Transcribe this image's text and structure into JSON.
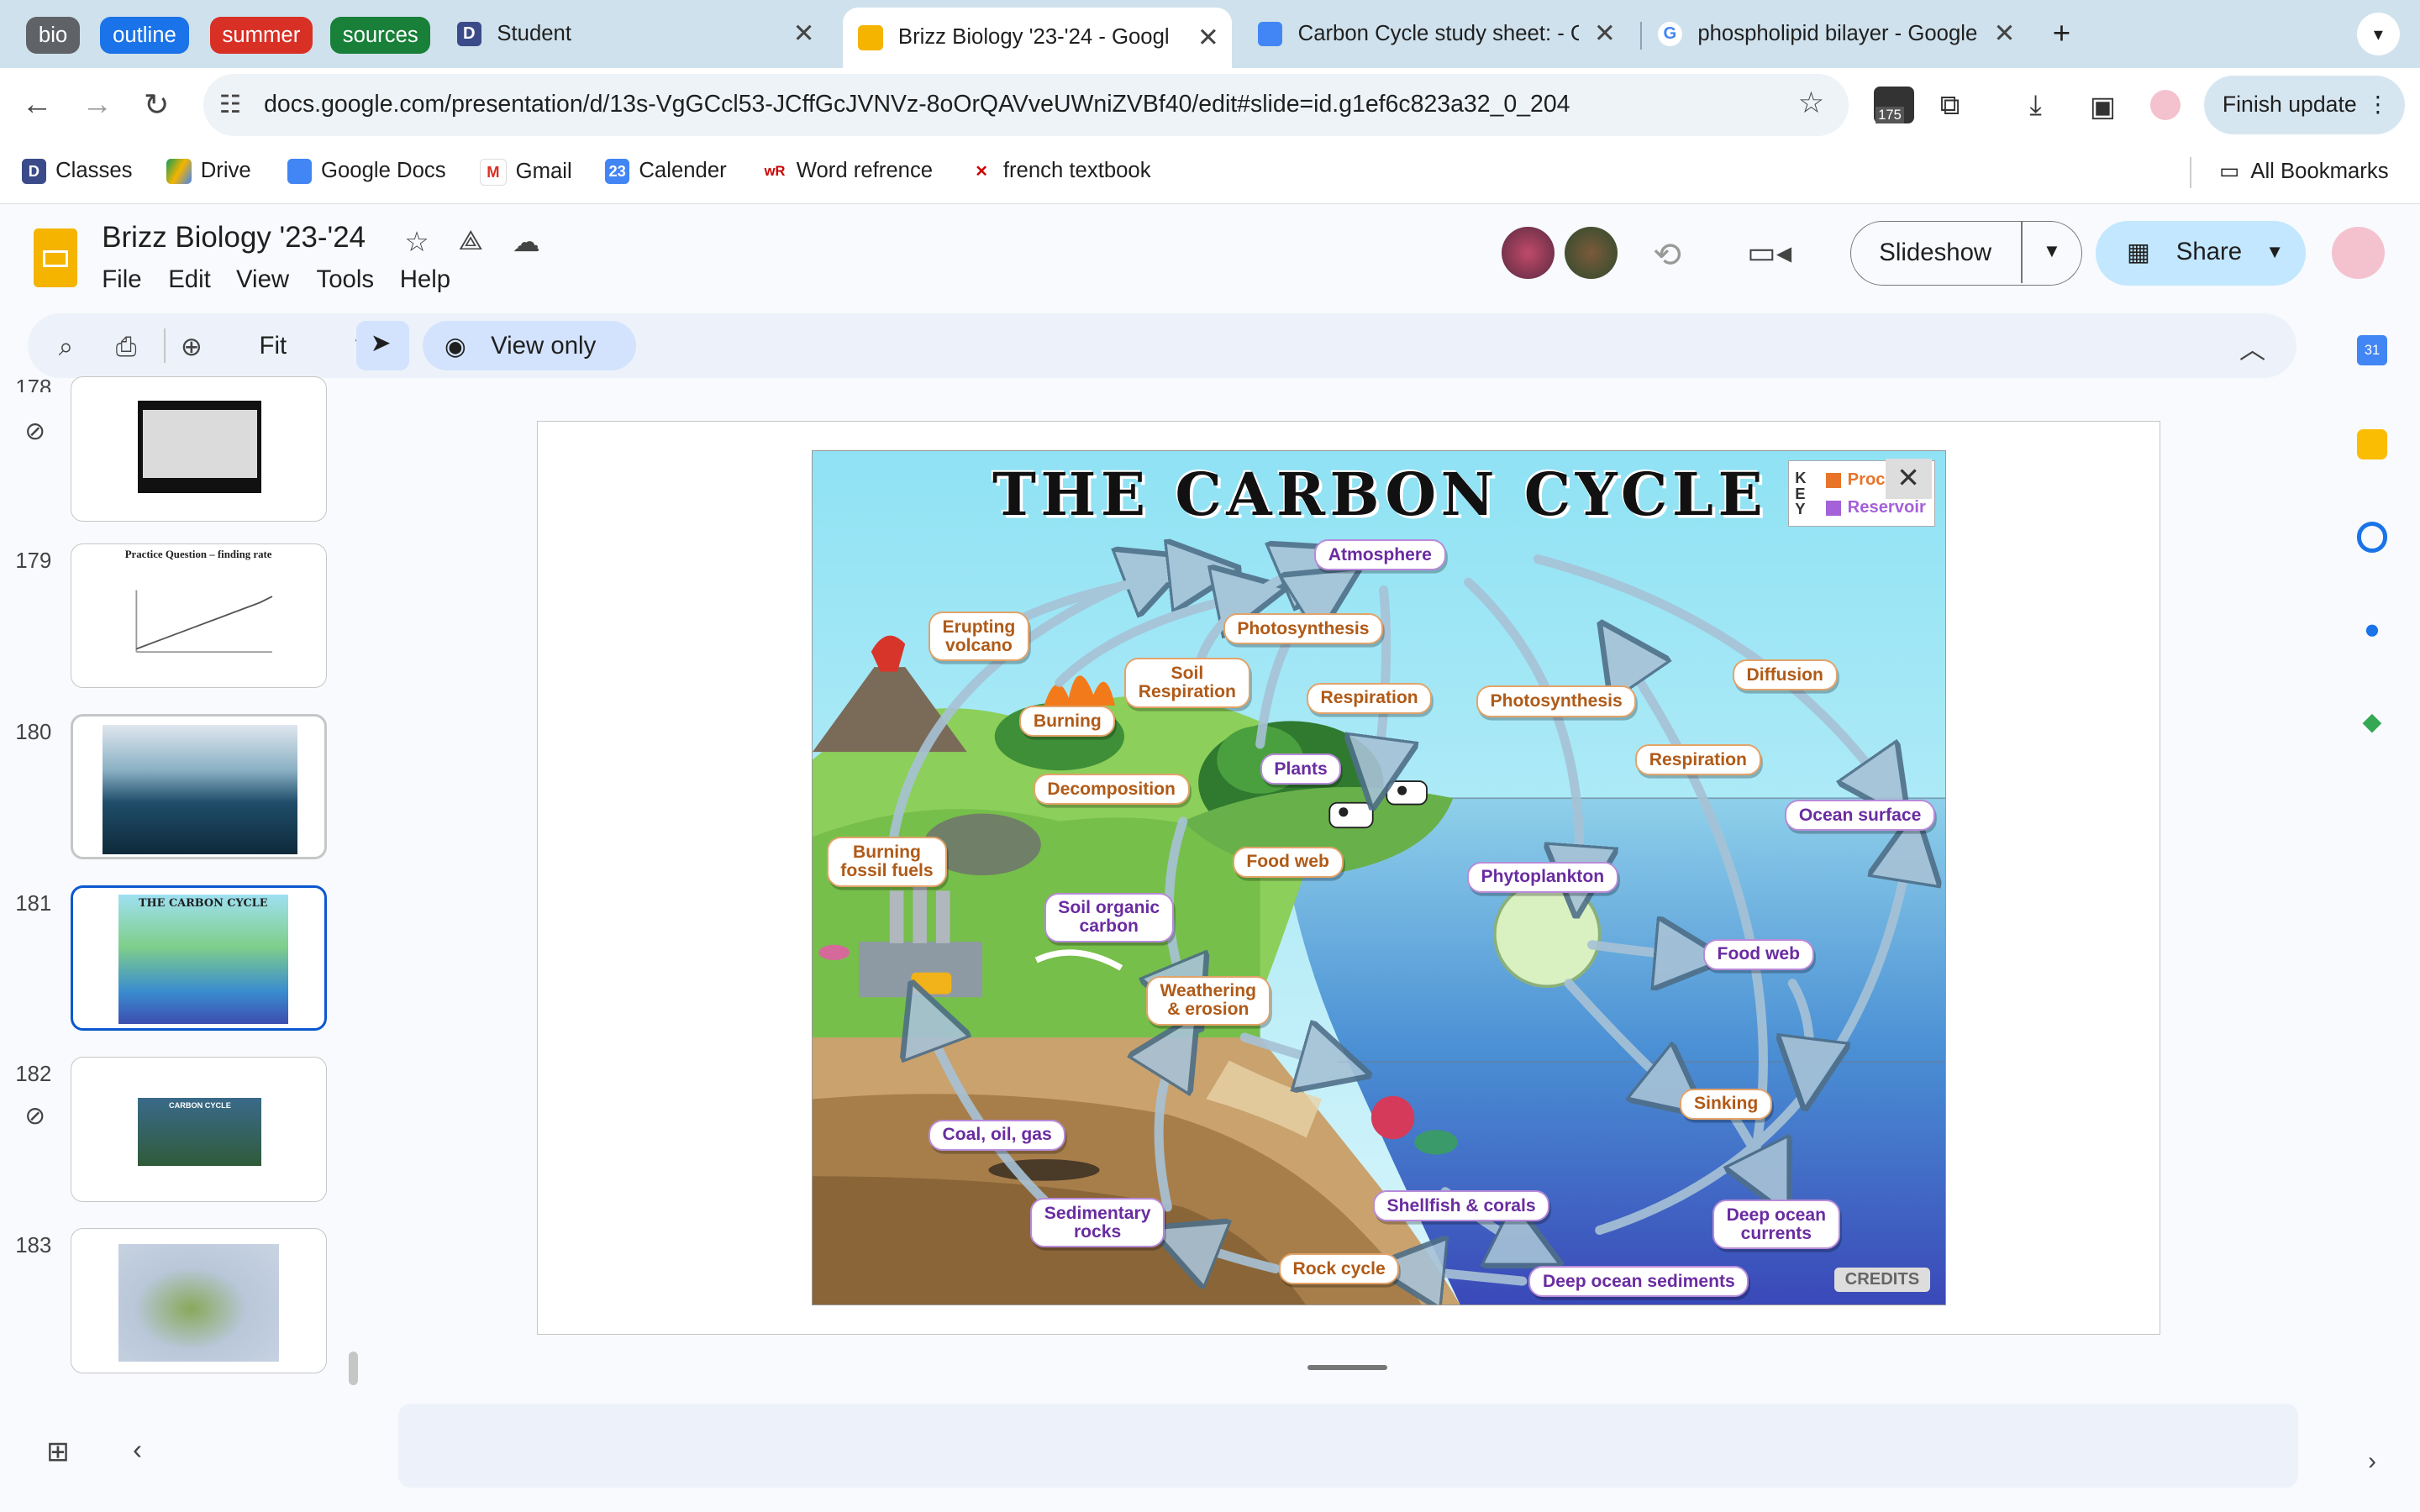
{
  "browser": {
    "tab_groups": [
      {
        "label": "bio",
        "color": "#5f6368"
      },
      {
        "label": "outline",
        "color": "#1a73e8"
      },
      {
        "label": "summer",
        "color": "#d93025"
      },
      {
        "label": "sources",
        "color": "#188038"
      }
    ],
    "tabs": [
      {
        "title": "Student",
        "favicon": "D"
      },
      {
        "title": "Brizz Biology '23-'24 - Googl",
        "favicon": "slides"
      },
      {
        "title": "Carbon Cycle study sheet: - G",
        "favicon": "docs"
      },
      {
        "title": "phospholipid bilayer - Google",
        "favicon": "G"
      }
    ],
    "url": "docs.google.com/presentation/d/13s-VgGCcl53-JCffGcJVNVz-8oOrQAVveUWniZVBf40/edit#slide=id.g1ef6c823a32_0_204",
    "extension_badge": "175",
    "finish_update": "Finish update",
    "bookmarks": [
      "Classes",
      "Drive",
      "Google Docs",
      "Gmail",
      "Calender",
      "Word refrence",
      "french textbook"
    ],
    "all_bookmarks": "All Bookmarks"
  },
  "app": {
    "doc_title": "Brizz Biology '23-'24",
    "menus": [
      "File",
      "Edit",
      "View",
      "Tools",
      "Help"
    ],
    "slideshow_label": "Slideshow",
    "share_label": "Share",
    "zoom_value": "Fit",
    "view_only_label": "View only"
  },
  "filmstrip": [
    {
      "number": "178",
      "partial": true
    },
    {
      "number": "179",
      "title": "Practice Question – finding rate"
    },
    {
      "number": "180"
    },
    {
      "number": "181",
      "title": "THE CARBON CYCLE",
      "selected": true
    },
    {
      "number": "182",
      "title": "CARBON CYCLE"
    },
    {
      "number": "183"
    }
  ],
  "slide": {
    "title": "THE CARBON CYCLE",
    "key": {
      "k": "KEY",
      "process": "Process",
      "reservoir": "Reservoir",
      "process_color": "#e8742a",
      "reservoir_color": "#a461d8"
    },
    "close": "✕",
    "credits": "CREDITS",
    "labels": {
      "atmosphere": "Atmosphere",
      "erupting_volcano": "Erupting\nvolcano",
      "photosynthesis_land": "Photosynthesis",
      "soil_respiration": "Soil\nRespiration",
      "respiration_land": "Respiration",
      "burning": "Burning",
      "photosynthesis_ocean": "Photosynthesis",
      "diffusion": "Diffusion",
      "respiration_ocean": "Respiration",
      "plants": "Plants",
      "decomposition": "Decomposition",
      "ocean_surface": "Ocean surface",
      "burning_fossil_fuels": "Burning\nfossil fuels",
      "food_web_land": "Food web",
      "phytoplankton": "Phytoplankton",
      "soil_organic_carbon": "Soil organic\ncarbon",
      "food_web_ocean": "Food web",
      "weathering_erosion": "Weathering\n& erosion",
      "sinking": "Sinking",
      "coal_oil_gas": "Coal, oil, gas",
      "shellfish_corals": "Shellfish & corals",
      "deep_ocean_currents": "Deep ocean\ncurrents",
      "sedimentary_rocks": "Sedimentary\nrocks",
      "rock_cycle": "Rock cycle",
      "deep_ocean_sediments": "Deep ocean sediments"
    }
  }
}
